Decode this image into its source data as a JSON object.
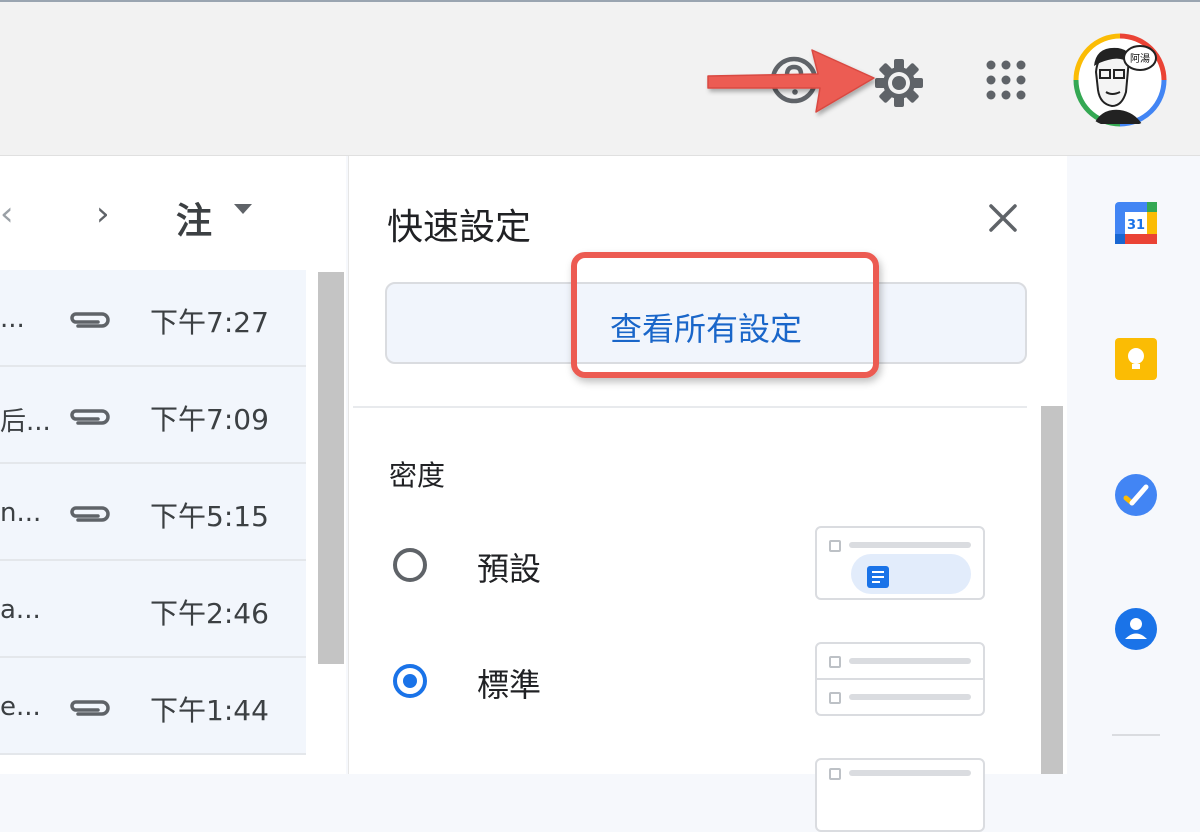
{
  "header": {
    "icons": [
      "help-icon",
      "settings-gear-icon",
      "google-apps-icon"
    ],
    "avatar_label": "阿湯"
  },
  "toolbar": {
    "sort_label": "注"
  },
  "mail_list": [
    {
      "snippet": " ...",
      "has_attachment": true,
      "time": "下午7:27"
    },
    {
      "snippet": "后...",
      "has_attachment": true,
      "time": "下午7:09"
    },
    {
      "snippet": "n...",
      "has_attachment": true,
      "time": "下午5:15"
    },
    {
      "snippet": "a...",
      "has_attachment": false,
      "time": "下午2:46"
    },
    {
      "snippet": "e...",
      "has_attachment": true,
      "time": "下午1:44"
    }
  ],
  "quick_settings": {
    "title": "快速設定",
    "view_all_label": "查看所有設定",
    "density_title": "密度",
    "options": [
      {
        "label": "預設",
        "selected": false
      },
      {
        "label": "標準",
        "selected": true
      }
    ]
  },
  "side_apps": [
    {
      "icon": "calendar-icon",
      "label": "31"
    },
    {
      "icon": "keep-icon"
    },
    {
      "icon": "tasks-icon"
    },
    {
      "icon": "contacts-icon"
    }
  ],
  "colors": {
    "accent": "#1a73e8",
    "link": "#1a66c9",
    "highlight": "#ec5b52"
  }
}
